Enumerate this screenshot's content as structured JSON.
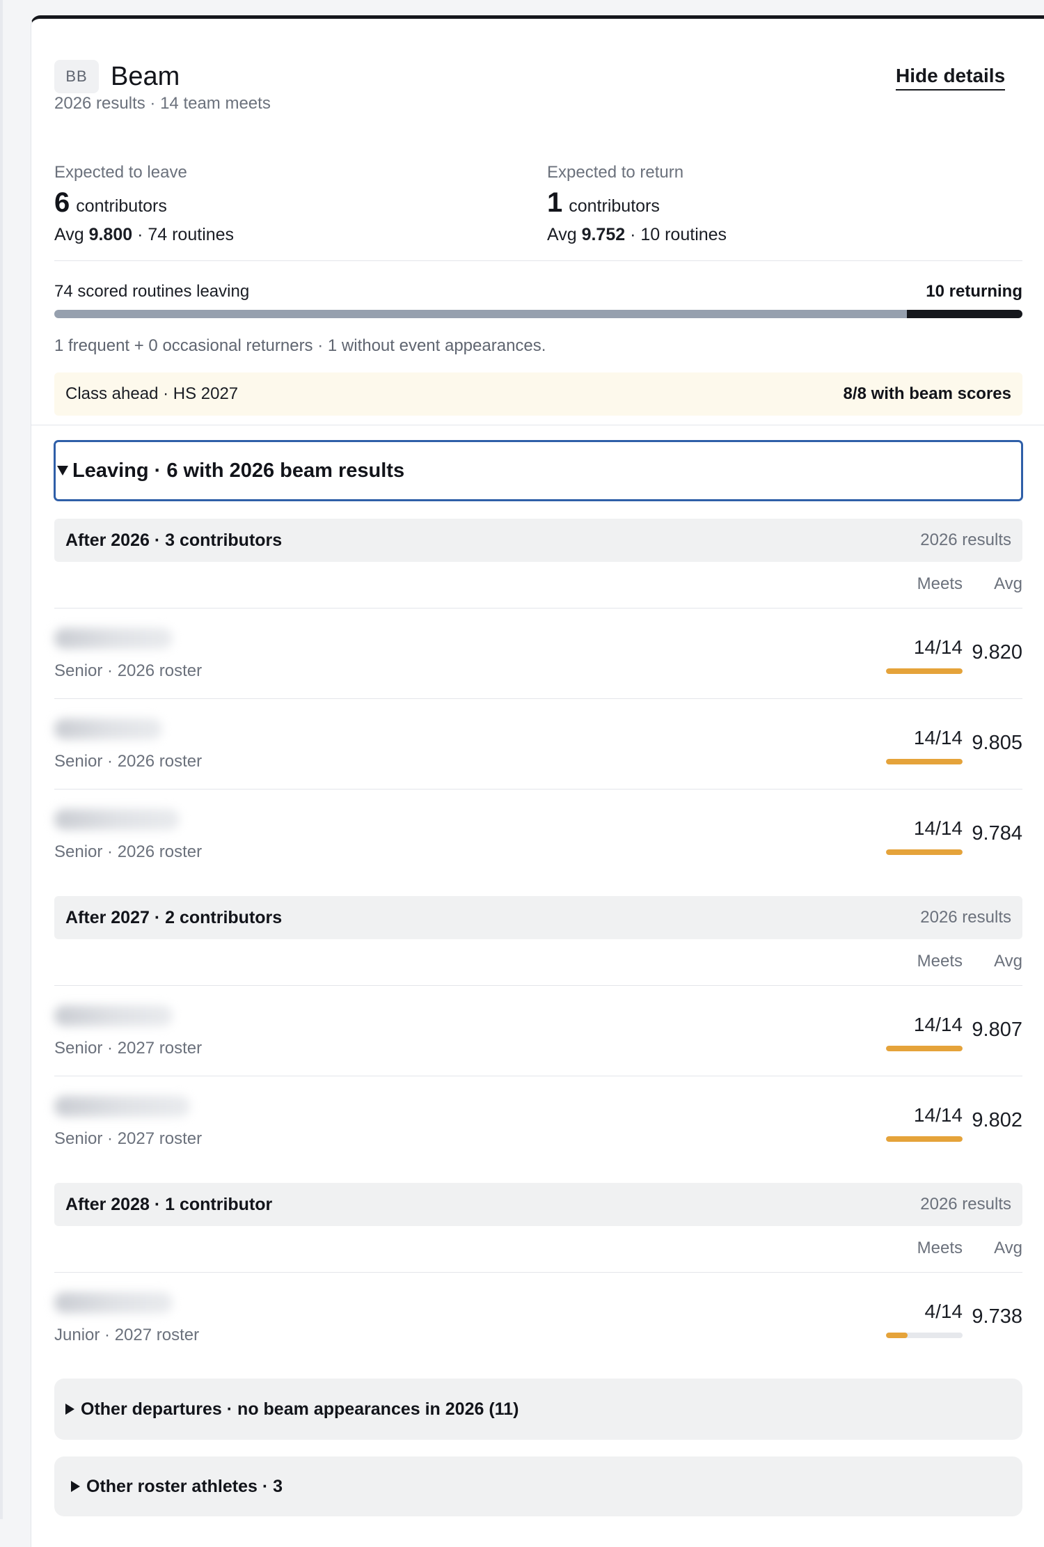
{
  "event": {
    "badge": "BB",
    "title": "Beam",
    "hide_details": "Hide details",
    "summary": "2026 results · 14 team meets"
  },
  "leave": {
    "label": "Expected to leave",
    "count": "6",
    "unit": "contributors",
    "avg_prefix": "Avg ",
    "avg": "9.800",
    "routines": " · 74 routines"
  },
  "return": {
    "label": "Expected to return",
    "count": "1",
    "unit": "contributors",
    "avg_prefix": "Avg ",
    "avg": "9.752",
    "routines": " · 10 routines"
  },
  "routines_bar": {
    "left_label": "74 scored routines leaving",
    "right_label": "10 returning",
    "leaving": 74,
    "returning": 10
  },
  "returners_note": "1 frequent + 0 occasional returners · 1 without event appearances.",
  "class_ahead": {
    "label": "Class ahead · HS 2027",
    "value": "8/8 with beam scores"
  },
  "leaving_section": "Leaving · 6 with 2026 beam results",
  "columns": {
    "meets": "Meets",
    "avg": "Avg"
  },
  "groups": [
    {
      "title": "After 2026 · 3 contributors",
      "right": "2026 results",
      "athletes": [
        {
          "roster": "Senior · 2026 roster",
          "meets": "14/14",
          "meets_fraction": 1.0,
          "avg": "9.820"
        },
        {
          "roster": "Senior · 2026 roster",
          "meets": "14/14",
          "meets_fraction": 1.0,
          "avg": "9.805"
        },
        {
          "roster": "Senior · 2026 roster",
          "meets": "14/14",
          "meets_fraction": 1.0,
          "avg": "9.784"
        }
      ]
    },
    {
      "title": "After 2027 · 2 contributors",
      "right": "2026 results",
      "athletes": [
        {
          "roster": "Senior · 2027 roster",
          "meets": "14/14",
          "meets_fraction": 1.0,
          "avg": "9.807"
        },
        {
          "roster": "Senior · 2027 roster",
          "meets": "14/14",
          "meets_fraction": 1.0,
          "avg": "9.802"
        }
      ]
    },
    {
      "title": "After 2028 · 1 contributor",
      "right": "2026 results",
      "athletes": [
        {
          "roster": "Junior · 2027 roster",
          "meets": "4/14",
          "meets_fraction": 0.286,
          "avg": "9.738"
        }
      ]
    }
  ],
  "other_departures": "Other departures · no beam appearances in 2026 (11)",
  "other_roster": "Other roster athletes · 3",
  "colors": {
    "accent_bar": "#e5a33a",
    "focus_border": "#2f5fa8",
    "returning_bar": "#15171c",
    "leaving_bar": "#96a0ae"
  }
}
